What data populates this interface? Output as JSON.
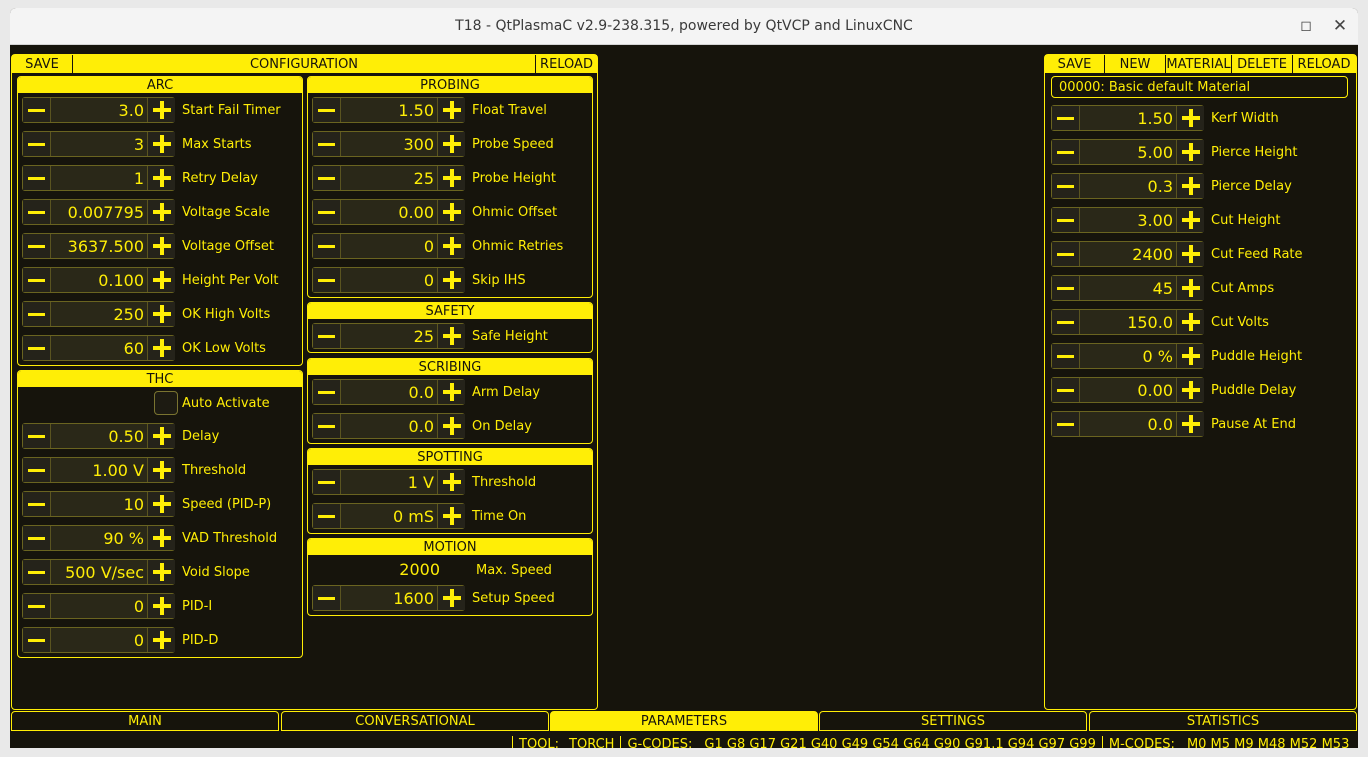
{
  "window": {
    "title": "T18 - QtPlasmaC v2.9-238.315, powered by QtVCP and LinuxCNC"
  },
  "colors": {
    "accent": "#ffee06",
    "background": "#16140c"
  },
  "config": {
    "save_label": "SAVE",
    "title": "CONFIGURATION",
    "reload_label": "RELOAD",
    "arc": {
      "title": "ARC",
      "rows": [
        {
          "value": "3.0",
          "label": "Start Fail Timer"
        },
        {
          "value": "3",
          "label": "Max Starts"
        },
        {
          "value": "1",
          "label": "Retry Delay"
        },
        {
          "value": "0.007795",
          "label": "Voltage Scale"
        },
        {
          "value": "3637.500",
          "label": "Voltage Offset"
        },
        {
          "value": "0.100",
          "label": "Height Per Volt"
        },
        {
          "value": "250",
          "label": "OK High Volts"
        },
        {
          "value": "60",
          "label": "OK Low Volts"
        }
      ]
    },
    "thc": {
      "title": "THC",
      "auto_activate": "Auto Activate",
      "rows": [
        {
          "value": "0.50",
          "label": "Delay"
        },
        {
          "value": "1.00 V",
          "label": "Threshold"
        },
        {
          "value": "10",
          "label": "Speed (PID-P)"
        },
        {
          "value": "90 %",
          "label": "VAD Threshold"
        },
        {
          "value": "500 V/sec",
          "label": "Void Slope"
        },
        {
          "value": "0",
          "label": "PID-I"
        },
        {
          "value": "0",
          "label": "PID-D"
        }
      ]
    },
    "probing": {
      "title": "PROBING",
      "rows": [
        {
          "value": "1.50",
          "label": "Float Travel"
        },
        {
          "value": "300",
          "label": "Probe Speed"
        },
        {
          "value": "25",
          "label": "Probe Height"
        },
        {
          "value": "0.00",
          "label": "Ohmic Offset"
        },
        {
          "value": "0",
          "label": "Ohmic Retries"
        },
        {
          "value": "0",
          "label": "Skip IHS"
        }
      ]
    },
    "safety": {
      "title": "SAFETY",
      "rows": [
        {
          "value": "25",
          "label": "Safe Height"
        }
      ]
    },
    "scribing": {
      "title": "SCRIBING",
      "rows": [
        {
          "value": "0.0",
          "label": "Arm Delay"
        },
        {
          "value": "0.0",
          "label": "On Delay"
        }
      ]
    },
    "spotting": {
      "title": "SPOTTING",
      "rows": [
        {
          "value": "1 V",
          "label": "Threshold"
        },
        {
          "value": "0 mS",
          "label": "Time On"
        }
      ]
    },
    "motion": {
      "title": "MOTION",
      "max_speed_value": "2000",
      "max_speed_label": "Max. Speed",
      "rows": [
        {
          "value": "1600",
          "label": "Setup Speed"
        }
      ]
    }
  },
  "material": {
    "buttons": [
      "SAVE",
      "NEW",
      "MATERIAL",
      "DELETE",
      "RELOAD"
    ],
    "selected": "00000: Basic default Material",
    "rows": [
      {
        "value": "1.50",
        "label": "Kerf Width"
      },
      {
        "value": "5.00",
        "label": "Pierce Height"
      },
      {
        "value": "0.3",
        "label": "Pierce Delay"
      },
      {
        "value": "3.00",
        "label": "Cut Height"
      },
      {
        "value": "2400",
        "label": "Cut Feed Rate"
      },
      {
        "value": "45",
        "label": "Cut Amps"
      },
      {
        "value": "150.0",
        "label": "Cut Volts"
      },
      {
        "value": "0 %",
        "label": "Puddle Height"
      },
      {
        "value": "0.00",
        "label": "Puddle Delay"
      },
      {
        "value": "0.0",
        "label": "Pause At End"
      }
    ]
  },
  "tabs": [
    "MAIN",
    "CONVERSATIONAL",
    "PARAMETERS",
    "SETTINGS",
    "STATISTICS"
  ],
  "active_tab": "PARAMETERS",
  "status": {
    "tool_label": "TOOL:",
    "tool_value": "TORCH",
    "gcodes_label": "G-CODES:",
    "gcodes_value": "G1 G8 G17 G21 G40 G49 G54 G64 G90 G91.1 G94 G97 G99",
    "mcodes_label": "M-CODES:",
    "mcodes_value": "M0 M5 M9 M48 M52 M53"
  }
}
